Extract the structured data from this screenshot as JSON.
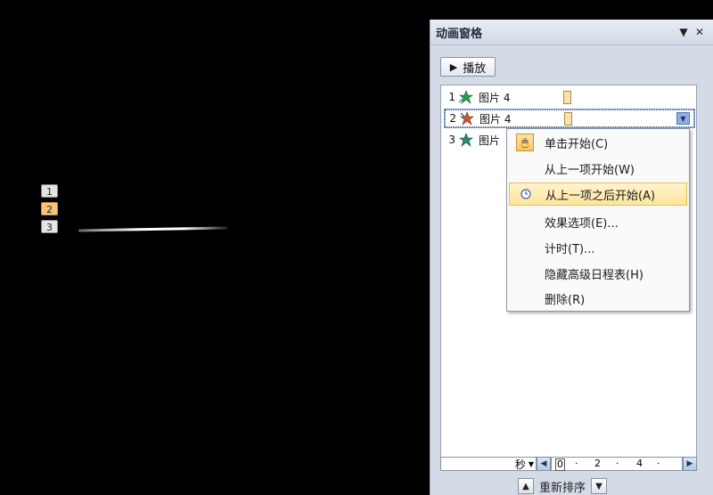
{
  "slide": {
    "markers": [
      "1",
      "2",
      "3"
    ]
  },
  "pane": {
    "title": "动画窗格",
    "dropdown_glyph": "▼",
    "close_glyph": "✕",
    "play_icon": "▶",
    "play_label": "播放"
  },
  "animations": [
    {
      "num": "1",
      "name": "图片 4",
      "icon": "enter-effect-icon"
    },
    {
      "num": "2",
      "name": "图片 4",
      "icon": "exit-effect-icon"
    },
    {
      "num": "3",
      "name": "图片",
      "icon": "emphasis-effect-icon"
    }
  ],
  "menu": {
    "items": [
      {
        "label": "单击开始(C)",
        "icon": "mouse-click-icon"
      },
      {
        "label": "从上一项开始(W)",
        "icon": ""
      },
      {
        "label": "从上一项之后开始(A)",
        "icon": "clock-icon"
      },
      {
        "label": "效果选项(E)...",
        "icon": ""
      },
      {
        "label": "计时(T)...",
        "icon": ""
      },
      {
        "label": "隐藏高级日程表(H)",
        "icon": ""
      },
      {
        "label": "删除(R)",
        "icon": ""
      }
    ]
  },
  "timeline": {
    "unit": "秒",
    "ticks": [
      "0",
      "2",
      "4"
    ]
  },
  "reorder": {
    "label": "重新排序"
  },
  "colors": {
    "highlight": "#fde59b",
    "pane_bg": "#d4dbe7",
    "bar_fill": "#fbe3a8"
  }
}
